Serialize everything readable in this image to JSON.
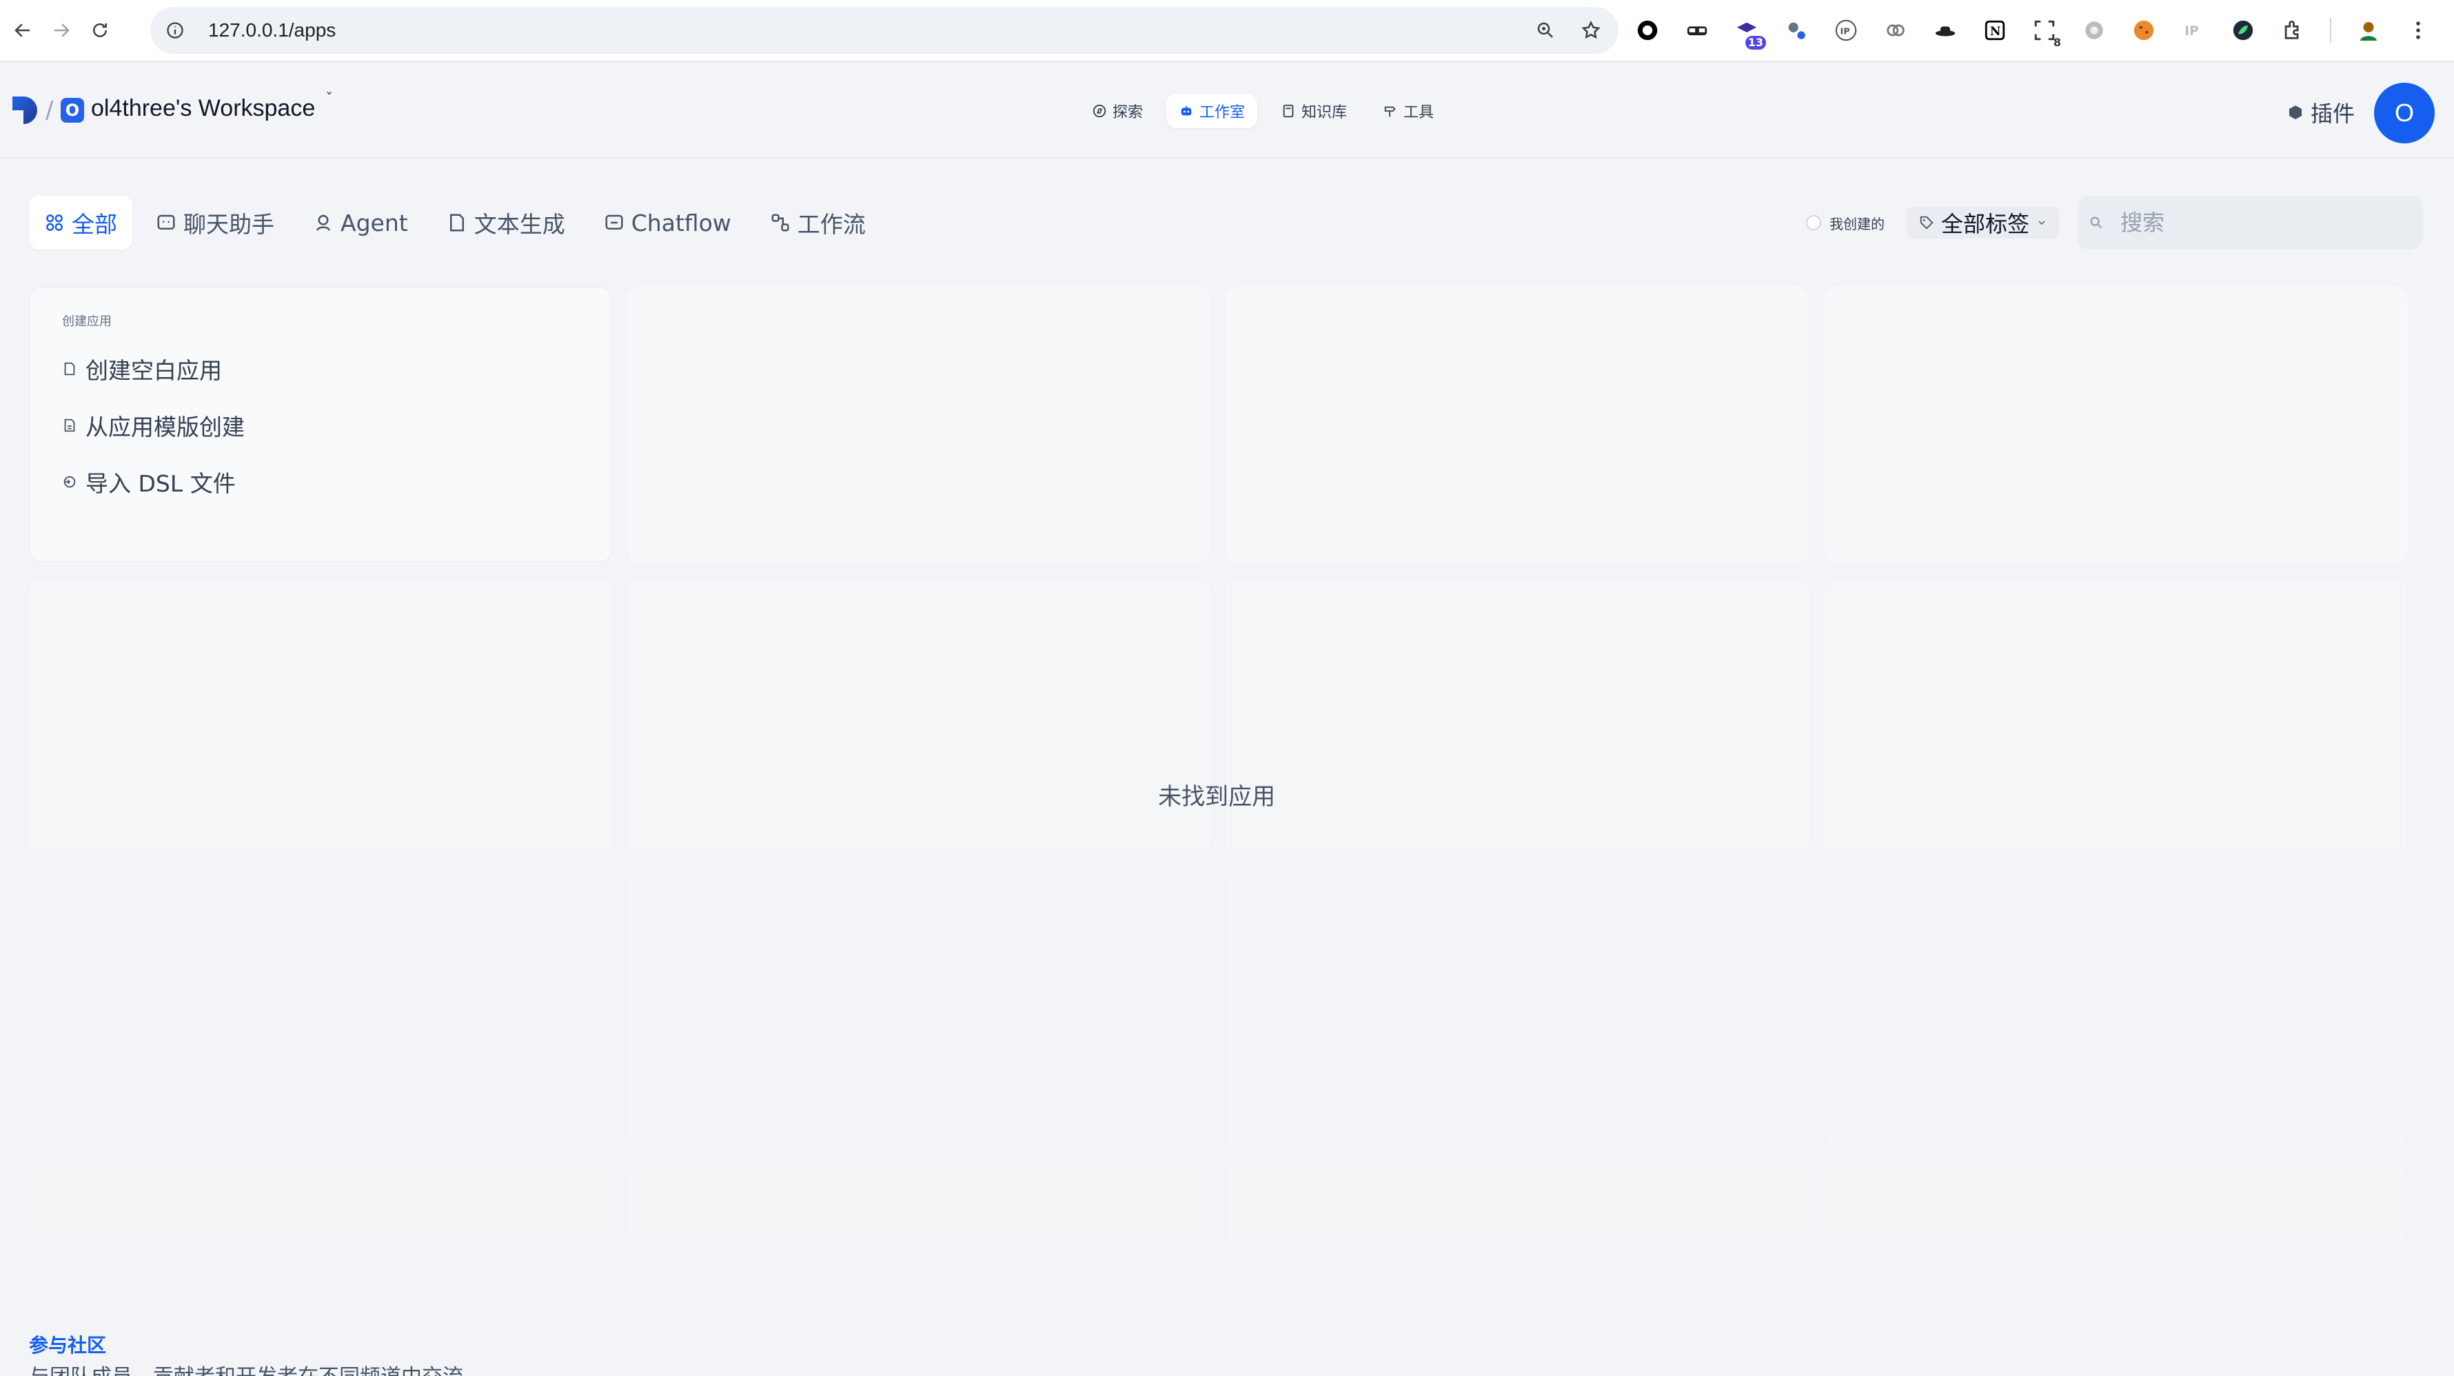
{
  "browser": {
    "url": "127.0.0.1/apps",
    "extension_badges": [
      "13",
      "8"
    ]
  },
  "header": {
    "workspace_initial": "O",
    "workspace_name": "ol4three's Workspace",
    "nav": [
      {
        "label": "探索",
        "icon": "compass-icon"
      },
      {
        "label": "工作室",
        "icon": "robot-icon",
        "active": true
      },
      {
        "label": "知识库",
        "icon": "book-icon"
      },
      {
        "label": "工具",
        "icon": "hammer-icon"
      }
    ],
    "plugins_label": "插件",
    "user_initial": "O"
  },
  "tabs": [
    {
      "label": "全部",
      "icon": "grid-icon",
      "active": true
    },
    {
      "label": "聊天助手",
      "icon": "chat-icon"
    },
    {
      "label": "Agent",
      "icon": "agent-icon"
    },
    {
      "label": "文本生成",
      "icon": "document-icon"
    },
    {
      "label": "Chatflow",
      "icon": "chatflow-icon"
    },
    {
      "label": "工作流",
      "icon": "workflow-icon"
    }
  ],
  "filters": {
    "mine_label": "我创建的",
    "tag_select_label": "全部标签",
    "search_placeholder": "搜索"
  },
  "create_card": {
    "title": "创建应用",
    "options": [
      {
        "label": "创建空白应用",
        "icon": "file-plus-icon"
      },
      {
        "label": "从应用模版创建",
        "icon": "template-icon"
      },
      {
        "label": "导入 DSL 文件",
        "icon": "import-icon"
      }
    ]
  },
  "empty_message": "未找到应用",
  "footer": {
    "community_title": "参与社区",
    "community_desc": "与团队成员、贡献者和开发者在不同频道中交流"
  },
  "colors": {
    "accent": "#155eef",
    "background": "#f2f4f7",
    "card": "#f7f8fa"
  }
}
